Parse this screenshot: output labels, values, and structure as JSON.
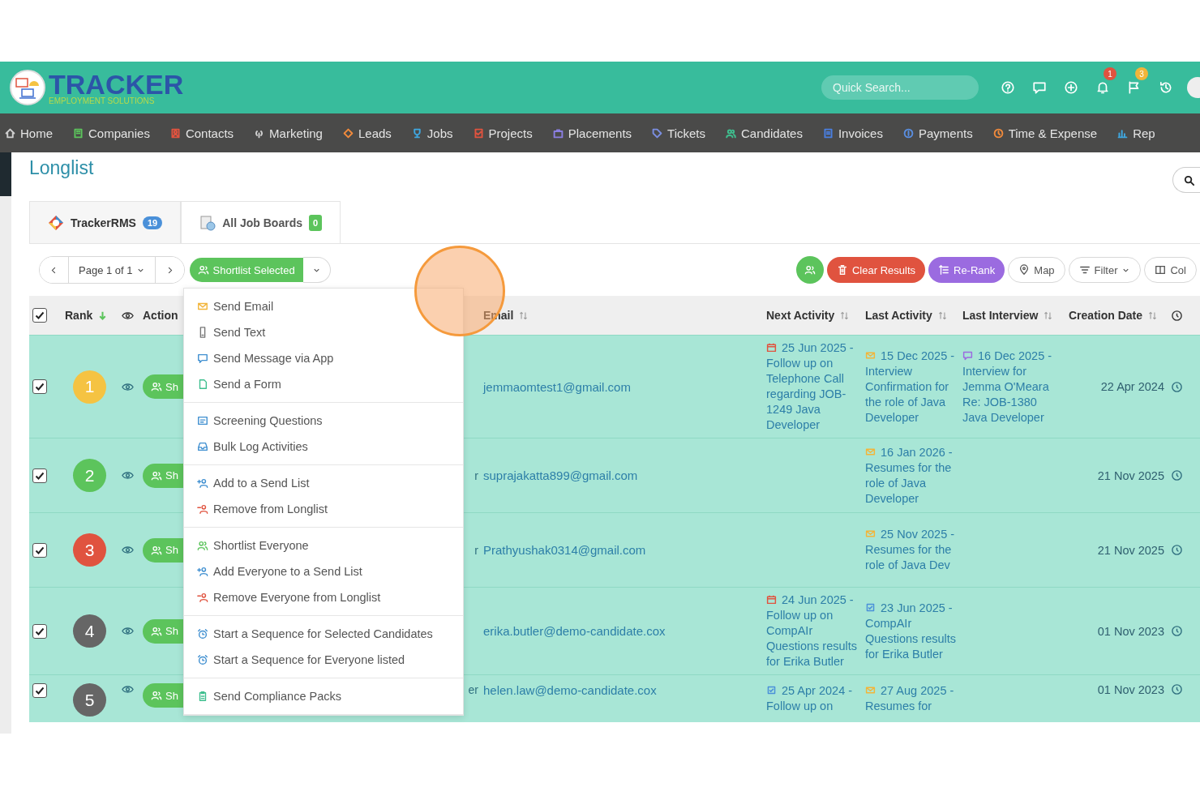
{
  "brand": {
    "name": "TRACKER",
    "tagline": "EMPLOYMENT SOLUTIONS"
  },
  "quick_search": {
    "placeholder": "Quick Search..."
  },
  "header_icons": [
    {
      "kind": "help"
    },
    {
      "kind": "chat"
    },
    {
      "kind": "plus"
    },
    {
      "kind": "bell",
      "badge": "1",
      "color": "#e0533f"
    },
    {
      "kind": "flag",
      "badge": "3",
      "color": "#f2b53a"
    },
    {
      "kind": "history"
    }
  ],
  "nav": [
    {
      "label": "Home",
      "kind": "home",
      "color": "#cfcfcf"
    },
    {
      "label": "Companies",
      "kind": "building",
      "color": "#5cc45c"
    },
    {
      "label": "Contacts",
      "kind": "contact",
      "color": "#e0533f"
    },
    {
      "label": "Marketing",
      "kind": "signal",
      "color": "#cfcfcf"
    },
    {
      "label": "Leads",
      "kind": "diamond",
      "color": "#f08a3c"
    },
    {
      "label": "Jobs",
      "kind": "trophy",
      "color": "#3fa7e0"
    },
    {
      "label": "Projects",
      "kind": "checklist",
      "color": "#e0533f"
    },
    {
      "label": "Placements",
      "kind": "briefcase",
      "color": "#8a7ee0"
    },
    {
      "label": "Tickets",
      "kind": "tag",
      "color": "#7b8ee0"
    },
    {
      "label": "Candidates",
      "kind": "users",
      "color": "#3fbf8f"
    },
    {
      "label": "Invoices",
      "kind": "invoice",
      "color": "#4a7fe0"
    },
    {
      "label": "Payments",
      "kind": "coin",
      "color": "#5a8ee0"
    },
    {
      "label": "Time & Expense",
      "kind": "clock",
      "color": "#f08a3c"
    },
    {
      "label": "Rep",
      "kind": "chart",
      "color": "#3fa7e0"
    }
  ],
  "page_title": "Longlist",
  "tabs": [
    {
      "label": "TrackerRMS",
      "count": "19",
      "color": "#4a90d9",
      "selected": true,
      "kind": "logo"
    },
    {
      "label": "All Job Boards",
      "count": "0",
      "color": "#5cc45c",
      "selected": false,
      "kind": "boards"
    }
  ],
  "pager": {
    "label": "Page 1 of 1"
  },
  "split_button": {
    "label": "Shortlist Selected"
  },
  "toolbar_buttons": [
    {
      "label": "Clear Results",
      "kind": "trash"
    },
    {
      "label": "Re-Rank",
      "kind": "rerank"
    },
    {
      "label": "Map",
      "kind": "pin"
    },
    {
      "label": "Filter",
      "kind": "filter"
    },
    {
      "label": "Col",
      "kind": "columns"
    }
  ],
  "table": {
    "all_checked": true,
    "columns": [
      {
        "label": "Rank"
      },
      {
        "label": "Action"
      },
      {
        "label": "Email"
      },
      {
        "label": "Next Activity"
      },
      {
        "label": "Last Activity"
      },
      {
        "label": "Last Interview"
      },
      {
        "label": "Creation Date"
      }
    ],
    "rows": [
      {
        "checked": true,
        "rank": "1",
        "color": "#f5c342",
        "action": "Sh",
        "email": "jemmaomtest1@gmail.com",
        "next_activity": {
          "kind": "calendar",
          "color": "#e0533f",
          "text": "25 Jun 2025 - Follow up on Telephone Call regarding JOB-1249 Java Developer"
        },
        "last_activity": {
          "kind": "mail",
          "color": "#f2b53a",
          "text": "15 Dec 2025 - Interview Confirmation for the role of Java Developer"
        },
        "last_interview": {
          "kind": "chat",
          "color": "#9b6be0",
          "text": "16 Dec 2025 - Interview for Jemma O'Meara Re: JOB-1380 Java Developer"
        },
        "created": "22 Apr 2024"
      },
      {
        "checked": true,
        "rank": "2",
        "color": "#5cc45c",
        "action": "Sh",
        "column_5": "r",
        "email": "suprajakatta899@gmail.com",
        "last_activity": {
          "kind": "mail",
          "color": "#f2b53a",
          "text": "16 Jan 2026 - Resumes for the role of Java Developer"
        },
        "created": "21 Nov 2025"
      },
      {
        "checked": true,
        "rank": "3",
        "color": "#e0533f",
        "action": "Sh",
        "column_5": "r",
        "email": "Prathyushak0314@gmail.com",
        "last_activity": {
          "kind": "mail",
          "color": "#f2b53a",
          "text": "25 Nov 2025 - Resumes for the role of Java Dev"
        },
        "created": "21 Nov 2025"
      },
      {
        "checked": true,
        "rank": "4",
        "color": "#666666",
        "action": "Sh",
        "email": "erika.butler@demo-candidate.cox",
        "next_activity": {
          "kind": "calendar",
          "color": "#e0533f",
          "text": "24 Jun 2025 - Follow up on CompAIr Questions results for Erika Butler"
        },
        "last_activity": {
          "kind": "task",
          "color": "#4a90d9",
          "text": "23 Jun 2025 - CompAIr Questions results for Erika Butler"
        },
        "created": "01 Nov 2023"
      },
      {
        "checked": true,
        "rank": "5",
        "color": "#666666",
        "action": "Sh",
        "column_5": "er",
        "email": "helen.law@demo-candidate.cox",
        "next_activity": {
          "kind": "task",
          "color": "#4a90d9",
          "text": "25 Apr 2024 - Follow up on"
        },
        "last_activity": {
          "kind": "mail",
          "color": "#f2b53a",
          "text": "27 Aug 2025 - Resumes for"
        },
        "created": "01 Nov 2023"
      }
    ]
  },
  "menu": [
    [
      {
        "label": "Send Email",
        "kind": "mail",
        "color": "#f2b53a"
      },
      {
        "label": "Send Text",
        "kind": "phone",
        "color": "#777777"
      },
      {
        "label": "Send Message via App",
        "kind": "chat",
        "color": "#3f8fd0"
      },
      {
        "label": "Send a Form",
        "kind": "form",
        "color": "#3fbf8f"
      }
    ],
    [
      {
        "label": "Screening Questions",
        "kind": "list",
        "color": "#3f8fd0"
      },
      {
        "label": "Bulk Log Activities",
        "kind": "inbox",
        "color": "#3f8fd0"
      }
    ],
    [
      {
        "label": "Add to a Send List",
        "kind": "user-plus",
        "color": "#3f8fd0"
      },
      {
        "label": "Remove from Longlist",
        "kind": "user-minus",
        "color": "#e0533f"
      }
    ],
    [
      {
        "label": "Shortlist Everyone",
        "kind": "users",
        "color": "#5cc45c"
      },
      {
        "label": "Add Everyone to a Send List",
        "kind": "user-plus",
        "color": "#3f8fd0"
      },
      {
        "label": "Remove Everyone from Longlist",
        "kind": "user-minus",
        "color": "#e0533f"
      }
    ],
    [
      {
        "label": "Start a Sequence for Selected Candidates",
        "kind": "alarm",
        "color": "#3f8fd0"
      },
      {
        "label": "Start a Sequence for Everyone listed",
        "kind": "alarm",
        "color": "#3f8fd0"
      }
    ],
    [
      {
        "label": "Send Compliance Packs",
        "kind": "clipboard",
        "color": "#3fbf8f"
      }
    ]
  ]
}
